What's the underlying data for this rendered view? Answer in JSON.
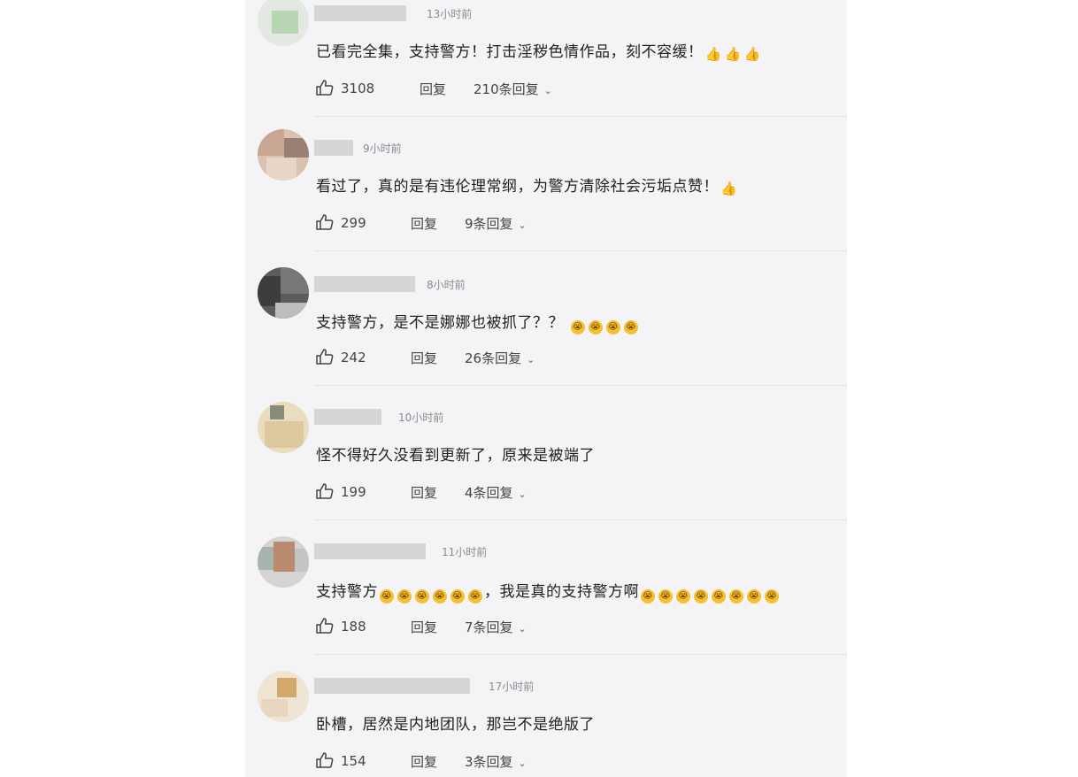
{
  "colors": {
    "panel_bg": "#f4f4f6",
    "text": "#1f1f1f",
    "meta": "#8a8a8f",
    "emoji": "#f6c033"
  },
  "comments": [
    {
      "time": "13小时前",
      "text": "已看完全集，支持警方！打击淫秽色情作品，刻不容缓！",
      "emoji": "thumbs-up",
      "emoji_count": 3,
      "likes": "3108",
      "reply": "回复",
      "replies": "210条回复"
    },
    {
      "time": "9小时前",
      "text": "看过了，真的是有违伦理常纲，为警方清除社会污垢点赞！",
      "emoji": "thumbs-up",
      "emoji_count": 1,
      "likes": "299",
      "reply": "回复",
      "replies": "9条回复"
    },
    {
      "time": "8小时前",
      "text": "支持警方，是不是娜娜也被抓了？？",
      "emoji": "crying-face",
      "emoji_count": 4,
      "likes": "242",
      "reply": "回复",
      "replies": "26条回复"
    },
    {
      "time": "10小时前",
      "text": "怪不得好久没看到更新了，原来是被端了",
      "emoji": "",
      "emoji_count": 0,
      "likes": "199",
      "reply": "回复",
      "replies": "4条回复"
    },
    {
      "time": "11小时前",
      "text": "支持警方",
      "emoji": "crying-face",
      "emoji_count": 6,
      "text2": "，我是真的支持警方啊",
      "emoji2_count": 8,
      "likes": "188",
      "reply": "回复",
      "replies": "7条回复"
    },
    {
      "time": "17小时前",
      "text": "卧槽，居然是内地团队，那岂不是绝版了",
      "emoji": "",
      "emoji_count": 0,
      "likes": "154",
      "reply": "回复",
      "replies": "3条回复"
    }
  ]
}
